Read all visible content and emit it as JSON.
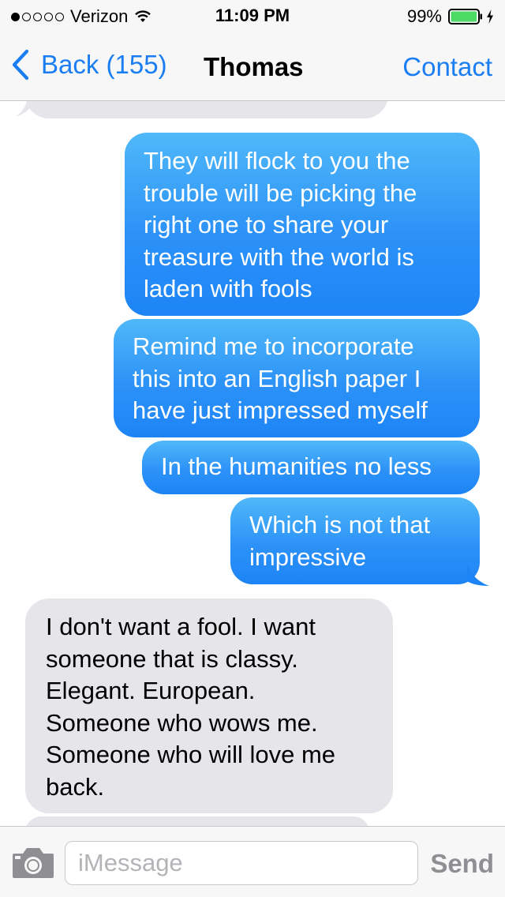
{
  "status_bar": {
    "carrier": "Verizon",
    "time": "11:09 PM",
    "battery_percent": "99%",
    "signal_bars": 1,
    "signal_total": 5,
    "battery_level": 0.99,
    "battery_color": "#4cd964",
    "icons": [
      "signal-dots-icon",
      "wifi-icon",
      "battery-icon",
      "charging-bolt-icon"
    ]
  },
  "nav": {
    "back_label": "Back (155)",
    "title": "Thomas",
    "contact_label": "Contact",
    "accent_color": "#1a7ef2"
  },
  "messages": [
    {
      "direction": "sent",
      "text": "They will flock to you the trouble will be picking the right one to share your treasure with the world is laden with fools"
    },
    {
      "direction": "sent",
      "text": "Remind me to incorporate this into an English paper I have just impressed myself"
    },
    {
      "direction": "sent",
      "text": "In the humanities no less"
    },
    {
      "direction": "sent",
      "text": "Which is not that impressive"
    },
    {
      "direction": "received",
      "text": "I don't want a fool. I want someone that is classy. Elegant. European. Someone who wows me. Someone who will love me back."
    }
  ],
  "messages_lines": [
    [
      "They will flock to you the",
      "trouble will be picking the",
      "right one to share your",
      "treasure with the world is",
      "laden with fools"
    ],
    [
      "Remind me to incorporate",
      "this into an English paper I",
      "have just impressed myself"
    ],
    [
      "In the humanities no less"
    ],
    [
      "Which is not that",
      "impressive"
    ],
    [
      "I don't want a fool. I want",
      "someone that is classy.",
      "Elegant. European.",
      "Someone who wows me.",
      "Someone who will love me",
      "back."
    ]
  ],
  "input_bar": {
    "placeholder": "iMessage",
    "value": "",
    "send_label": "Send",
    "camera_icon": "camera-icon"
  },
  "colors": {
    "sent_bubble_top": "#4fb8f9",
    "sent_bubble_bottom": "#1d84f6",
    "received_bubble": "#e5e5ea",
    "bar_background": "#f7f7f8"
  }
}
